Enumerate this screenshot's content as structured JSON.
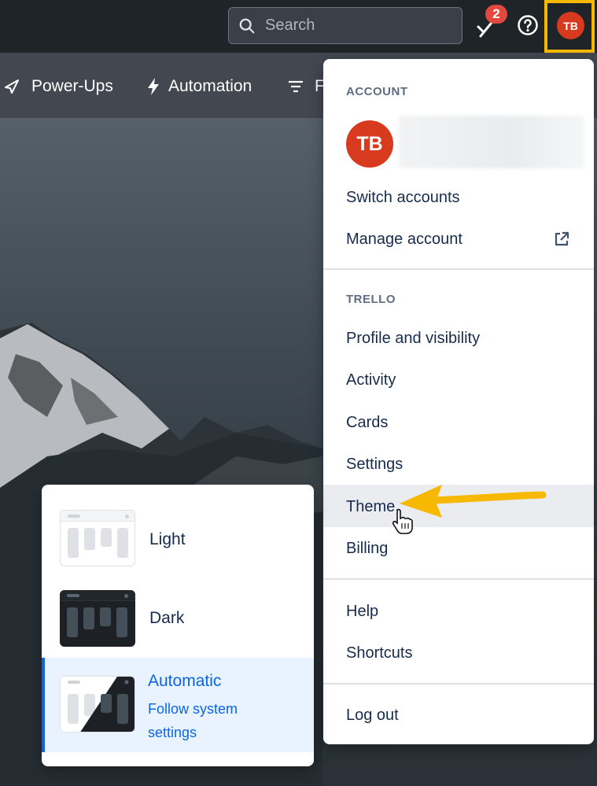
{
  "topbar": {
    "search_placeholder": "Search",
    "notification_count": "2",
    "avatar_initials": "TB"
  },
  "boardbar": {
    "items": [
      {
        "label": "Power-Ups",
        "icon": "rocket-icon"
      },
      {
        "label": "Automation",
        "icon": "lightning-icon"
      },
      {
        "label": "F",
        "icon": "filter-icon"
      }
    ]
  },
  "account_menu": {
    "account_title": "ACCOUNT",
    "avatar_initials": "TB",
    "switch_accounts": "Switch accounts",
    "manage_account": "Manage account",
    "trello_title": "TRELLO",
    "profile": "Profile and visibility",
    "activity": "Activity",
    "cards": "Cards",
    "settings": "Settings",
    "theme": "Theme",
    "billing": "Billing",
    "help": "Help",
    "shortcuts": "Shortcuts",
    "logout": "Log out"
  },
  "theme_menu": {
    "light": "Light",
    "dark": "Dark",
    "automatic": "Automatic",
    "automatic_desc": "Follow system settings",
    "selected": "Automatic"
  },
  "colors": {
    "avatar": "#d83a1f",
    "highlight_frame": "#f6b900",
    "arrow": "#f6b900",
    "selected_accent": "#0c66e4"
  }
}
